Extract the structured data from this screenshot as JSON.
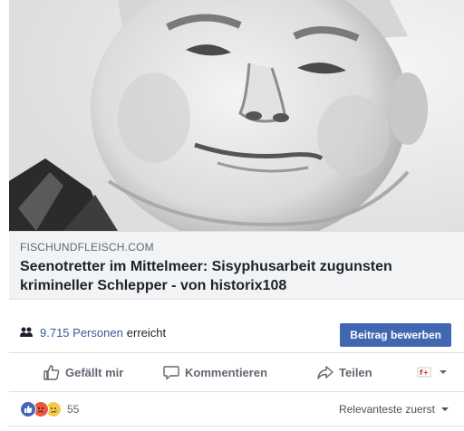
{
  "post": {
    "link": {
      "domain": "FISCHUNDFLEISCH.COM",
      "title": "Seenotretter im Mittelmeer: Sisyphusarbeit zugunsten krimineller Schlepper - von historix108"
    },
    "reach": {
      "count": "9.715 Personen",
      "suffix": "erreicht",
      "icon": "people-icon"
    },
    "boost_label": "Beitrag bewerben",
    "actions": {
      "like": "Gefällt mir",
      "comment": "Kommentieren",
      "share": "Teilen"
    },
    "reactions": {
      "count": "55",
      "types": [
        "like",
        "angry",
        "sad"
      ]
    },
    "sort_label": "Relevanteste zuerst"
  },
  "colors": {
    "link_blue": "#385898",
    "button_blue": "#4267b2",
    "gray_text": "#606770"
  }
}
